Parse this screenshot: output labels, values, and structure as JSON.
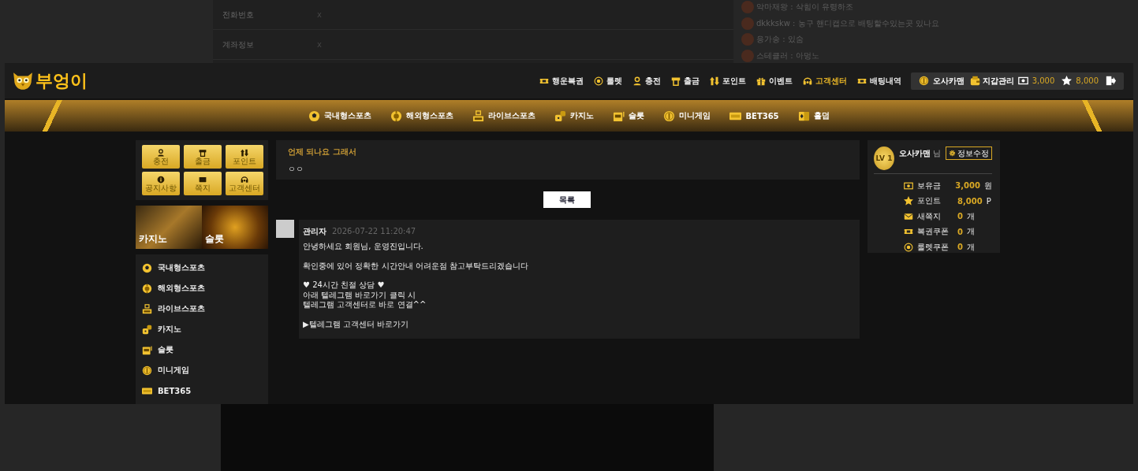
{
  "backdrop": {
    "info_rows": [
      {
        "label": "전화번호",
        "value": "x"
      },
      {
        "label": "계좌정보",
        "value": "x"
      }
    ],
    "chat": [
      "악마재왕 : 삭힘이 유령하조",
      "dkkkskw : 농구 핸디캡으로 배팅할수있는곳 있나요",
      "응가송 : 있숨",
      "스테클러 : 아멍노"
    ]
  },
  "header": {
    "logo": "부엉이",
    "menu": [
      {
        "kind": "ticket",
        "label": "행운복권",
        "selected": false
      },
      {
        "kind": "wheel",
        "label": "룰렛",
        "selected": false
      },
      {
        "kind": "person",
        "label": "충전",
        "selected": false
      },
      {
        "kind": "atm",
        "label": "출금",
        "selected": false
      },
      {
        "kind": "arrows",
        "label": "포인트",
        "selected": false
      },
      {
        "kind": "gift",
        "label": "이벤트",
        "selected": false
      },
      {
        "kind": "headset",
        "label": "고객센터",
        "selected": true
      },
      {
        "kind": "ticket",
        "label": "배팅내역",
        "selected": false
      }
    ],
    "user_box": {
      "username": "오사카맨",
      "wallet": "지갑관리",
      "money": "3,000",
      "points": "8,000"
    }
  },
  "nav": [
    {
      "kind": "ball",
      "label": "국내형스포츠"
    },
    {
      "kind": "chip",
      "label": "해외형스포츠"
    },
    {
      "kind": "tv",
      "label": "라이브스포츠"
    },
    {
      "kind": "dice",
      "label": "카지노"
    },
    {
      "kind": "slot",
      "label": "슬롯"
    },
    {
      "kind": "coin",
      "label": "미니게임"
    },
    {
      "kind": "tile",
      "label": "BET365"
    },
    {
      "kind": "cards",
      "label": "홀덤"
    }
  ],
  "sidebar": {
    "quick_buttons": [
      {
        "kind": "person",
        "label": "충전"
      },
      {
        "kind": "atm",
        "label": "출금"
      },
      {
        "kind": "arrows",
        "label": "포인트"
      },
      {
        "kind": "info",
        "label": "공지사항"
      },
      {
        "kind": "envelope",
        "label": "쪽지"
      },
      {
        "kind": "headset",
        "label": "고객센터"
      }
    ],
    "banners": [
      "카지노",
      "슬롯"
    ],
    "menu": [
      {
        "kind": "ball",
        "label": "국내형스포츠"
      },
      {
        "kind": "chip",
        "label": "해외형스포츠"
      },
      {
        "kind": "tv",
        "label": "라이브스포츠"
      },
      {
        "kind": "dice",
        "label": "카지노"
      },
      {
        "kind": "slot",
        "label": "슬롯"
      },
      {
        "kind": "coin",
        "label": "미니게임"
      },
      {
        "kind": "tile",
        "label": "BET365"
      }
    ]
  },
  "post": {
    "title": "언제 되나요 그래서",
    "body": "ㅇㅇ",
    "list_button": "목록"
  },
  "reply": {
    "author": "관리자",
    "date": "2026-07-22 11:20:47",
    "paragraphs": [
      [
        "안녕하세요 회원님, 운영진입니다."
      ],
      [
        "확인중에 있어 정확한 시간안내 어려운점 참고부탁드리겠습니다"
      ],
      [
        "♥ 24시간 친절 상담 ♥",
        "아래 텔레그램 바로가기 클릭 시",
        "텔레그램 고객센터로 바로 연결^^"
      ]
    ],
    "link": "▶텔레그램 고객센터 바로가기"
  },
  "profile": {
    "level": "LV 1",
    "username": "오사카맨",
    "suffix": "님",
    "edit_button": "정보수정",
    "stats": [
      {
        "kind": "cash",
        "label": "보유금",
        "value": "3,000",
        "unit": "원"
      },
      {
        "kind": "star",
        "label": "포인트",
        "value": "8,000",
        "unit": "P"
      },
      {
        "kind": "envelope",
        "label": "새쪽지",
        "value": "0",
        "unit": "개"
      },
      {
        "kind": "ticket",
        "label": "복권쿠폰",
        "value": "0",
        "unit": "개"
      },
      {
        "kind": "wheel",
        "label": "룰렛쿠폰",
        "value": "0",
        "unit": "개"
      }
    ]
  }
}
